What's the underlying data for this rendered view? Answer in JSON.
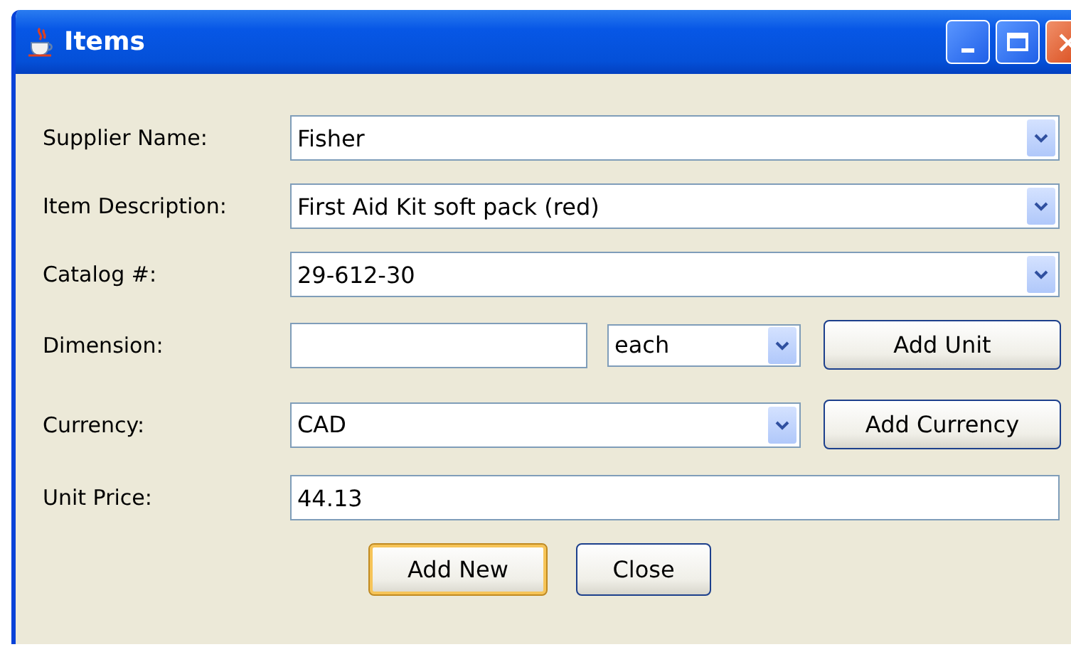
{
  "window": {
    "title": "Items"
  },
  "fields": [
    {
      "kind": "combo",
      "label": "Supplier Name:",
      "value": "Fisher"
    },
    {
      "kind": "combo",
      "label": "Item Description:",
      "value": "First Aid Kit soft pack (red)"
    },
    {
      "kind": "combo",
      "label": "Catalog #:",
      "value": "29-612-30"
    },
    {
      "kind": "dimension",
      "label": "Dimension:",
      "unit": "each",
      "button": "Add Unit"
    },
    {
      "kind": "combo_button",
      "label": "Currency:",
      "value": "CAD",
      "button": "Add Currency"
    },
    {
      "kind": "text",
      "label": "Unit Price:",
      "value": "44.13"
    }
  ],
  "buttons": [
    {
      "label": "Add New",
      "focused": true
    },
    {
      "label": "Close",
      "focused": false
    }
  ]
}
